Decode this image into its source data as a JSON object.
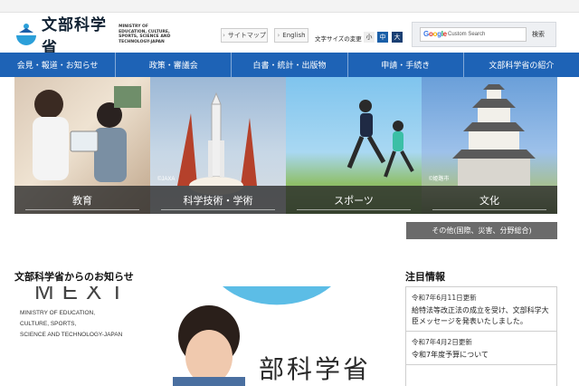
{
  "header": {
    "logo_jp": "文部科学省",
    "logo_en": "MINISTRY OF EDUCATION, CULTURE, SPORTS, SCIENCE AND TECHNOLOGY-JAPAN",
    "sitemap_label": "サイトマップ",
    "english_label": "English",
    "font_size_label": "文字サイズの変更",
    "font_small": "小",
    "font_medium": "中",
    "font_large": "大",
    "search_placeholder": "Custom Search",
    "search_brand": "Google",
    "search_button": "検索"
  },
  "nav": {
    "items": [
      "会見・報道・お知らせ",
      "政策・審議会",
      "白書・統計・出版物",
      "申請・手続き",
      "文部科学省の紹介"
    ]
  },
  "hero": {
    "panels": [
      {
        "label": "教育",
        "credit": ""
      },
      {
        "label": "科学技術・学術",
        "credit": "©JAXA"
      },
      {
        "label": "スポーツ",
        "credit": ""
      },
      {
        "label": "文化",
        "credit": "©姫路市"
      }
    ],
    "other_label": "その他(国際、災害、分野総合)"
  },
  "news": {
    "title": "文部科学省からのお知らせ",
    "image_text": {
      "mext": "MEXT",
      "line1": "MINISTRY OF EDUCATION,",
      "line2": "CULTURE, SPORTS,",
      "line3": "SCIENCE AND TECHNOLOGY-JAPAN",
      "kanji": "部科学省"
    }
  },
  "hot": {
    "title": "注目情報",
    "items": [
      {
        "date": "令和7年6月11日更新",
        "text": "給特法等改正法の成立を受け、文部科学大臣メッセージを発表いたしました。"
      },
      {
        "date": "令和7年4月2日更新",
        "text": "令和7年度予算について"
      }
    ]
  },
  "colors": {
    "nav_bg": "#1e63b6",
    "accent": "#1a5fa8"
  }
}
